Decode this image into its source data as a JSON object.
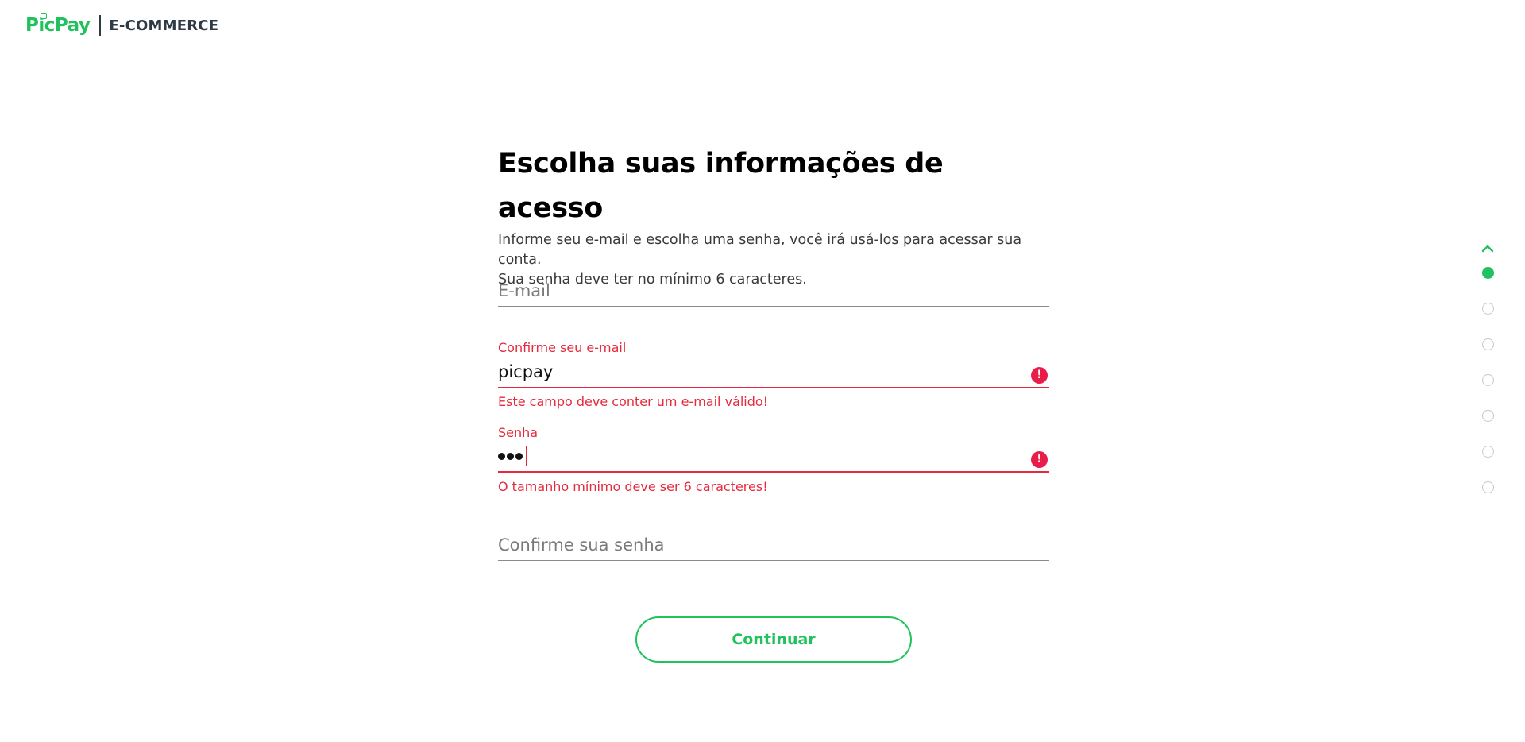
{
  "header": {
    "brand": "PicPay",
    "section": "E-COMMERCE"
  },
  "form": {
    "title": "Escolha suas informações de acesso",
    "description_line1": "Informe seu e-mail e escolha uma senha, você irá usá-los para acessar sua conta.",
    "description_line2": "Sua senha deve ter no mínimo 6 caracteres.",
    "email": {
      "placeholder": "E-mail",
      "value": ""
    },
    "confirm_email": {
      "label": "Confirme seu e-mail",
      "value": "picpay",
      "error": "Este campo deve conter um e-mail válido!"
    },
    "password": {
      "label": "Senha",
      "masked_length": 3,
      "error": "O tamanho mínimo deve ser 6 caracteres!"
    },
    "confirm_password": {
      "placeholder": "Confirme sua senha",
      "value": ""
    },
    "submit_label": "Continuar"
  },
  "steps": {
    "total": 7,
    "current": 1
  },
  "colors": {
    "brand_green": "#21c25e",
    "error_red": "#e52a3b",
    "logo_dark": "#2e3a44"
  },
  "icons": {
    "error": "exclamation-circle-icon",
    "step_up": "chevron-up-icon"
  }
}
